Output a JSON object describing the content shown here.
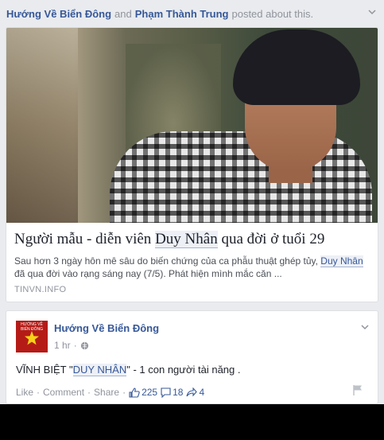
{
  "share_header": {
    "actor1": "Hướng Về Biển Đông",
    "conjunction": "and",
    "actor2": "Phạm Thành Trung",
    "suffix": "posted about this."
  },
  "article": {
    "title_before": "Người mẫu - diễn viên ",
    "title_highlight": "Duy Nhân",
    "title_after": " qua đời ở tuổi 29",
    "desc_before": "Sau hơn 3 ngày hôn mê sâu do biến chứng của ca phẫu thuật ghép tủy, ",
    "desc_highlight": "Duy Nhân",
    "desc_after": " đã qua đời vào rạng sáng nay (7/5). Phát hiện mình mắc căn ...",
    "source": "TINVN.INFO"
  },
  "post": {
    "page_name": "Hướng Về Biển Đông",
    "avatar_text": "HƯỚNG VỀ BIỂN ĐÔNG",
    "time": "1 hr",
    "text_before": "VĨNH BIỆT \"",
    "text_highlight": "DUY NHÂN",
    "text_after": "\" - 1 con người tài năng .",
    "actions": {
      "like": "Like",
      "comment": "Comment",
      "share": "Share",
      "likes_count": "225",
      "comments_count": "18",
      "shares_count": "4"
    }
  },
  "colors": {
    "link": "#365899",
    "muted": "#90949c",
    "avatar_bg": "#b51b16",
    "star": "#f7d117"
  },
  "icons": [
    "chevron-down-icon",
    "globe-icon",
    "thumbs-up-icon",
    "comment-icon",
    "share-arrow-icon",
    "flag-icon",
    "star-icon"
  ]
}
